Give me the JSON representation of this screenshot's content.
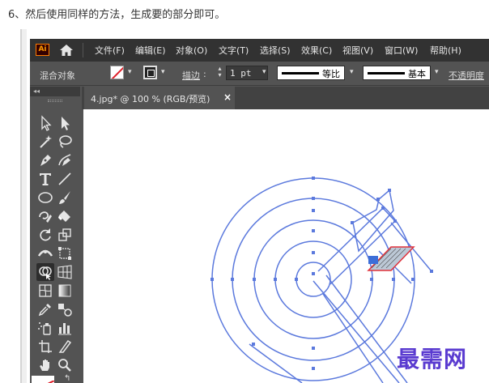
{
  "caption": "6、然后使用同样的方法，生成要的部分即可。",
  "app": {
    "logo": "Ai",
    "home_icon": "home-icon",
    "menu": [
      "文件(F)",
      "编辑(E)",
      "对象(O)",
      "文字(T)",
      "选择(S)",
      "效果(C)",
      "视图(V)",
      "窗口(W)",
      "帮助(H)"
    ]
  },
  "control_bar": {
    "selection_label": "混合对象",
    "stroke_label": "描边",
    "stroke_weight": "1 pt",
    "profile_label": "等比",
    "brush_label": "基本",
    "opacity_label": "不透明度"
  },
  "document_tab": {
    "title": "4.jpg* @ 100 % (RGB/预览)",
    "close": "×"
  },
  "toolbar": {
    "header": "◂◂",
    "tools": [
      "selection-tool-icon",
      "direct-selection-tool-icon",
      "magic-wand-tool-icon",
      "lasso-tool-icon",
      "pen-tool-icon",
      "curvature-tool-icon",
      "type-tool-icon",
      "line-segment-tool-icon",
      "ellipse-tool-icon",
      "paintbrush-tool-icon",
      "shaper-tool-icon",
      "eraser-tool-icon",
      "rotate-tool-icon",
      "scale-tool-icon",
      "width-tool-icon",
      "free-transform-tool-icon",
      "shape-builder-tool-icon",
      "perspective-grid-tool-icon",
      "mesh-tool-icon",
      "gradient-tool-icon",
      "eyedropper-tool-icon",
      "blend-tool-icon",
      "symbol-sprayer-tool-icon",
      "column-graph-tool-icon",
      "artboard-tool-icon",
      "slice-tool-icon",
      "hand-tool-icon",
      "zoom-tool-icon"
    ]
  },
  "colors": {
    "path": "#5b79dd",
    "selection": "#e0303a",
    "ui_dark": "#323232",
    "ui_mid": "#535353",
    "watermark": "#5a3bd0"
  },
  "watermark": "最需网"
}
